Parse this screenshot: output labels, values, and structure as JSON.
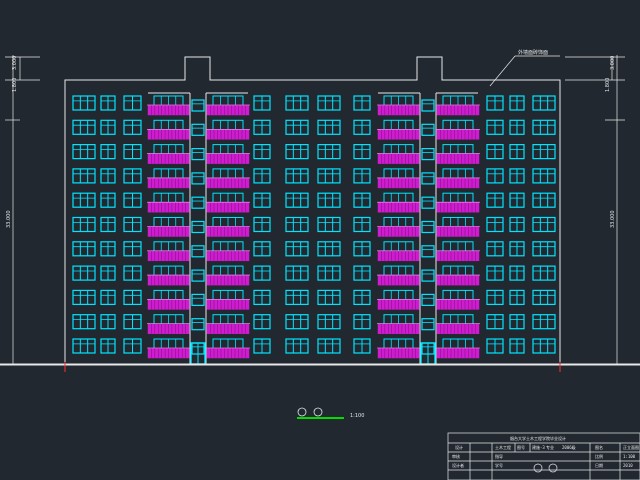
{
  "drawing": {
    "background": "#212830",
    "line_color": "#e8e8e8",
    "window_color": "#00e5ff",
    "balcony_color": "#d01cd0",
    "ground_color": "#e8e8e8",
    "red_mark_color": "#ff3030",
    "scale_bar_color": "#00dd00",
    "floors": 11,
    "callout_note": "外墙面砖饰面",
    "dim_left_top": "3.000",
    "dim_left_mid": "1.800",
    "dim_left_main": "33.000",
    "dim_right_top": "3.000",
    "dim_right_mid": "1.800",
    "dim_right_main": "33.000",
    "scale_label": "1:100"
  },
  "title_block": {
    "project": "烟台大学土木工程学院毕业设计",
    "r2c1": "设计",
    "r2c2": "土木工程",
    "r2c3": "图号",
    "r2c4": "建施-3",
    "r2c5": "专业",
    "r2c6": "2006级",
    "r2c7": "图名",
    "r2c8": "正立面图",
    "r3c1": "审核",
    "r3c2": "指导",
    "r3c3": "比例",
    "r3c4": "1:100",
    "r4c1": "设计者",
    "r4c2": "学号",
    "r4c3": "日期",
    "r4c4": "2010"
  }
}
